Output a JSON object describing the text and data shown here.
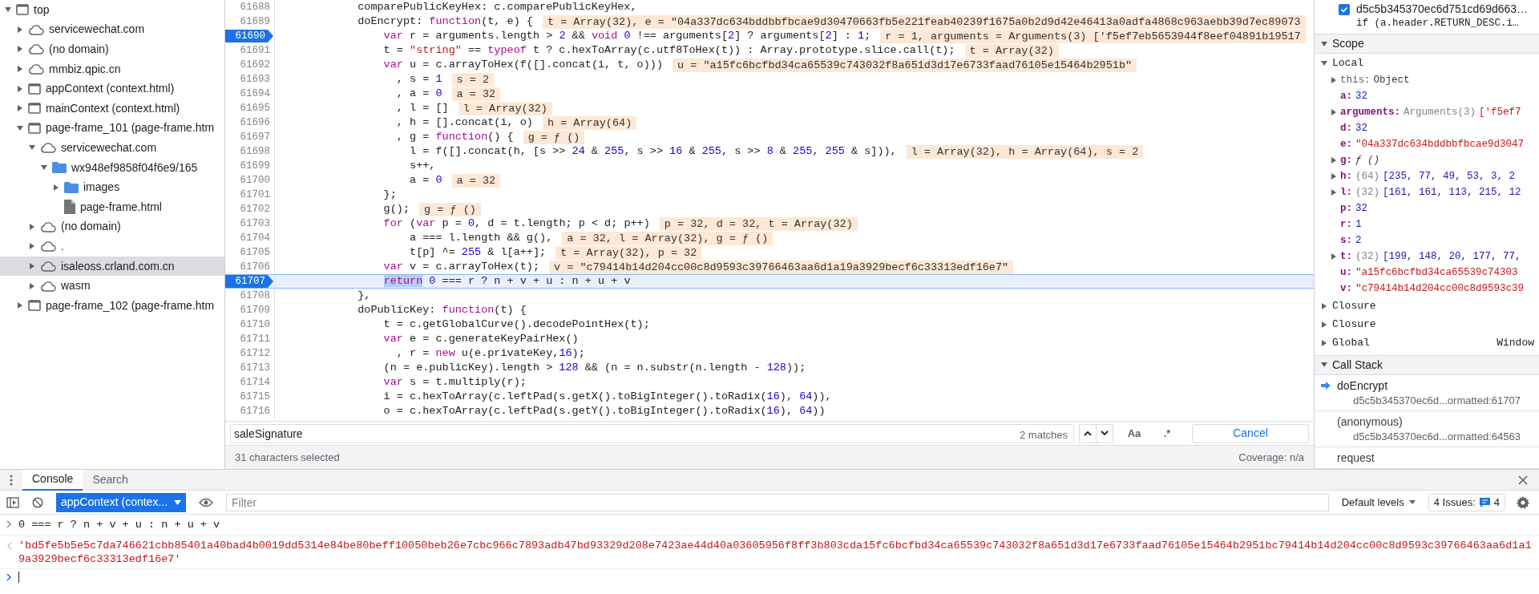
{
  "sidebar": {
    "tree": [
      {
        "label": "top",
        "kind": "frame",
        "expanded": true,
        "selected": false,
        "children": [
          {
            "label": "servicewechat.com",
            "kind": "cloud",
            "expanded": false,
            "selected": false
          },
          {
            "label": "(no domain)",
            "kind": "cloud",
            "expanded": false,
            "selected": false
          },
          {
            "label": "mmbiz.qpic.cn",
            "kind": "cloud",
            "expanded": false,
            "selected": false
          },
          {
            "label": "appContext (context.html)",
            "kind": "frame",
            "expanded": false,
            "selected": false
          },
          {
            "label": "mainContext (context.html)",
            "kind": "frame",
            "expanded": false,
            "selected": false
          },
          {
            "label": "page-frame_101 (page-frame.htm",
            "kind": "frame",
            "expanded": true,
            "selected": false,
            "children": [
              {
                "label": "servicewechat.com",
                "kind": "cloud",
                "expanded": true,
                "selected": false,
                "children": [
                  {
                    "label": "wx948ef9858f04f6e9/165",
                    "kind": "folder",
                    "expanded": true,
                    "selected": false,
                    "children": [
                      {
                        "label": "images",
                        "kind": "folder",
                        "expanded": false,
                        "selected": false
                      },
                      {
                        "label": "page-frame.html",
                        "kind": "file",
                        "selected": false
                      }
                    ]
                  }
                ]
              },
              {
                "label": "(no domain)",
                "kind": "cloud",
                "expanded": false,
                "selected": false
              },
              {
                "label": ".",
                "kind": "cloud",
                "expanded": false,
                "selected": false
              },
              {
                "label": "isaleoss.crland.com.cn",
                "kind": "cloud",
                "expanded": false,
                "selected": true
              },
              {
                "label": "wasm",
                "kind": "cloud",
                "expanded": false,
                "selected": false
              }
            ]
          },
          {
            "label": "page-frame_102 (page-frame.htm",
            "kind": "frame",
            "expanded": false,
            "selected": false
          }
        ]
      }
    ]
  },
  "editor": {
    "lines": [
      {
        "number": "61688",
        "breakpoint": false,
        "current": false,
        "tokens": [
          {
            "kind": "plain",
            "text": "            comparePublicKeyHex: c.comparePublicKeyHex,"
          }
        ]
      },
      {
        "number": "61689",
        "breakpoint": false,
        "current": false,
        "tokens": [
          {
            "kind": "plain",
            "text": "            doEncrypt: "
          },
          {
            "kind": "keyword",
            "text": "function"
          },
          {
            "kind": "plain",
            "text": "(t, e) {"
          }
        ],
        "inline_value": "t = Array(32), e = \"04a337dc634bddbbfbcae9d30470663fb5e221feab40239f1675a0b2d9d42e46413a0adfa4868c963aebb39d7ec89073"
      },
      {
        "number": "61690",
        "breakpoint": true,
        "current": false,
        "tokens": [
          {
            "kind": "keyword",
            "text": "                var"
          },
          {
            "kind": "plain",
            "text": " r = arguments.length > "
          },
          {
            "kind": "number",
            "text": "2"
          },
          {
            "kind": "plain",
            "text": " && "
          },
          {
            "kind": "keyword",
            "text": "void"
          },
          {
            "kind": "number",
            "text": " 0"
          },
          {
            "kind": "plain",
            "text": " !== arguments["
          },
          {
            "kind": "number",
            "text": "2"
          },
          {
            "kind": "plain",
            "text": "] ? arguments["
          },
          {
            "kind": "number",
            "text": "2"
          },
          {
            "kind": "plain",
            "text": "] : "
          },
          {
            "kind": "number",
            "text": "1"
          },
          {
            "kind": "plain",
            "text": ";"
          }
        ],
        "inline_value": "r = 1, arguments = Arguments(3) ['f5ef7eb5653944f8eef04891b19517"
      },
      {
        "number": "61691",
        "breakpoint": false,
        "current": false,
        "tokens": [
          {
            "kind": "plain",
            "text": "                t = "
          },
          {
            "kind": "string",
            "text": "\"string\""
          },
          {
            "kind": "plain",
            "text": " == "
          },
          {
            "kind": "keyword",
            "text": "typeof"
          },
          {
            "kind": "plain",
            "text": " t ? c.hexToArray(c.utf8ToHex(t)) : Array.prototype.slice.call(t);"
          }
        ],
        "inline_value": "t = Array(32)"
      },
      {
        "number": "61692",
        "breakpoint": false,
        "current": false,
        "tokens": [
          {
            "kind": "keyword",
            "text": "                var"
          },
          {
            "kind": "plain",
            "text": " u = c.arrayToHex(f([].concat(i, t, o)))"
          }
        ],
        "inline_value": "u = \"a15fc6bcfbd34ca65539c743032f8a651d3d17e6733faad76105e15464b2951b\""
      },
      {
        "number": "61693",
        "breakpoint": false,
        "current": false,
        "tokens": [
          {
            "kind": "plain",
            "text": "                  , s = "
          },
          {
            "kind": "number",
            "text": "1"
          }
        ],
        "inline_value": "s = 2"
      },
      {
        "number": "61694",
        "breakpoint": false,
        "current": false,
        "tokens": [
          {
            "kind": "plain",
            "text": "                  , a = "
          },
          {
            "kind": "number",
            "text": "0"
          }
        ],
        "inline_value": "a = 32"
      },
      {
        "number": "61695",
        "breakpoint": false,
        "current": false,
        "tokens": [
          {
            "kind": "plain",
            "text": "                  , l = []"
          }
        ],
        "inline_value": "l = Array(32)"
      },
      {
        "number": "61696",
        "breakpoint": false,
        "current": false,
        "tokens": [
          {
            "kind": "plain",
            "text": "                  , h = [].concat(i, o)"
          }
        ],
        "inline_value": "h = Array(64)"
      },
      {
        "number": "61697",
        "breakpoint": false,
        "current": false,
        "tokens": [
          {
            "kind": "plain",
            "text": "                  , g = "
          },
          {
            "kind": "keyword",
            "text": "function"
          },
          {
            "kind": "plain",
            "text": "() {"
          }
        ],
        "inline_value": "g = ƒ ()"
      },
      {
        "number": "61698",
        "breakpoint": false,
        "current": false,
        "tokens": [
          {
            "kind": "plain",
            "text": "                    l = f([].concat(h, [s >> "
          },
          {
            "kind": "number",
            "text": "24"
          },
          {
            "kind": "plain",
            "text": " & "
          },
          {
            "kind": "number",
            "text": "255"
          },
          {
            "kind": "plain",
            "text": ", s >> "
          },
          {
            "kind": "number",
            "text": "16"
          },
          {
            "kind": "plain",
            "text": " & "
          },
          {
            "kind": "number",
            "text": "255"
          },
          {
            "kind": "plain",
            "text": ", s >> "
          },
          {
            "kind": "number",
            "text": "8"
          },
          {
            "kind": "plain",
            "text": " & "
          },
          {
            "kind": "number",
            "text": "255"
          },
          {
            "kind": "plain",
            "text": ", "
          },
          {
            "kind": "number",
            "text": "255"
          },
          {
            "kind": "plain",
            "text": " & s])),"
          }
        ],
        "inline_value": "l = Array(32), h = Array(64), s = 2"
      },
      {
        "number": "61699",
        "breakpoint": false,
        "current": false,
        "tokens": [
          {
            "kind": "plain",
            "text": "                    s++,"
          }
        ]
      },
      {
        "number": "61700",
        "breakpoint": false,
        "current": false,
        "tokens": [
          {
            "kind": "plain",
            "text": "                    a = "
          },
          {
            "kind": "number",
            "text": "0"
          }
        ],
        "inline_value": "a = 32"
      },
      {
        "number": "61701",
        "breakpoint": false,
        "current": false,
        "tokens": [
          {
            "kind": "plain",
            "text": "                };"
          }
        ]
      },
      {
        "number": "61702",
        "breakpoint": false,
        "current": false,
        "tokens": [
          {
            "kind": "plain",
            "text": "                g();"
          }
        ],
        "inline_value": "g = ƒ ()"
      },
      {
        "number": "61703",
        "breakpoint": false,
        "current": false,
        "tokens": [
          {
            "kind": "keyword",
            "text": "                for"
          },
          {
            "kind": "plain",
            "text": " ("
          },
          {
            "kind": "keyword",
            "text": "var"
          },
          {
            "kind": "plain",
            "text": " p = "
          },
          {
            "kind": "number",
            "text": "0"
          },
          {
            "kind": "plain",
            "text": ", d = t.length; p < d; p++)"
          }
        ],
        "inline_value": "p = 32, d = 32, t = Array(32)"
      },
      {
        "number": "61704",
        "breakpoint": false,
        "current": false,
        "tokens": [
          {
            "kind": "plain",
            "text": "                    a === l.length && g(),"
          }
        ],
        "inline_value": "a = 32, l = Array(32), g = ƒ ()"
      },
      {
        "number": "61705",
        "breakpoint": false,
        "current": false,
        "tokens": [
          {
            "kind": "plain",
            "text": "                    t[p] ^= "
          },
          {
            "kind": "number",
            "text": "255"
          },
          {
            "kind": "plain",
            "text": " & l[a++];"
          }
        ],
        "inline_value": "t = Array(32), p = 32"
      },
      {
        "number": "61706",
        "breakpoint": false,
        "current": false,
        "tokens": [
          {
            "kind": "keyword",
            "text": "                var"
          },
          {
            "kind": "plain",
            "text": " v = c.arrayToHex(t);"
          }
        ],
        "inline_value": "v = \"c79414b14d204cc00c8d9593c39766463aa6d1a19a3929becf6c33313edf16e7\""
      },
      {
        "number": "61707",
        "breakpoint": true,
        "current": true,
        "tokens": [
          {
            "kind": "selected_keyword",
            "text": "                return"
          },
          {
            "kind": "number",
            "text": " 0"
          },
          {
            "kind": "plain",
            "text": " === r ? n + v + u : n + u + v"
          }
        ]
      },
      {
        "number": "61708",
        "breakpoint": false,
        "current": false,
        "tokens": [
          {
            "kind": "plain",
            "text": "            },"
          }
        ]
      },
      {
        "number": "61709",
        "breakpoint": false,
        "current": false,
        "tokens": [
          {
            "kind": "plain",
            "text": "            doPublicKey: "
          },
          {
            "kind": "keyword",
            "text": "function"
          },
          {
            "kind": "plain",
            "text": "(t) {"
          }
        ]
      },
      {
        "number": "61710",
        "breakpoint": false,
        "current": false,
        "tokens": [
          {
            "kind": "plain",
            "text": "                t = c.getGlobalCurve().decodePointHex(t);"
          }
        ]
      },
      {
        "number": "61711",
        "breakpoint": false,
        "current": false,
        "tokens": [
          {
            "kind": "keyword",
            "text": "                var"
          },
          {
            "kind": "plain",
            "text": " e = c.generateKeyPairHex()"
          }
        ]
      },
      {
        "number": "61712",
        "breakpoint": false,
        "current": false,
        "tokens": [
          {
            "kind": "plain",
            "text": "                  , r = "
          },
          {
            "kind": "keyword",
            "text": "new"
          },
          {
            "kind": "plain",
            "text": " u(e.privateKey,"
          },
          {
            "kind": "number",
            "text": "16"
          },
          {
            "kind": "plain",
            "text": ");"
          }
        ]
      },
      {
        "number": "61713",
        "breakpoint": false,
        "current": false,
        "tokens": [
          {
            "kind": "plain",
            "text": "                (n = e.publicKey).length > "
          },
          {
            "kind": "number",
            "text": "128"
          },
          {
            "kind": "plain",
            "text": " && (n = n.substr(n.length - "
          },
          {
            "kind": "number",
            "text": "128"
          },
          {
            "kind": "plain",
            "text": "));"
          }
        ]
      },
      {
        "number": "61714",
        "breakpoint": false,
        "current": false,
        "tokens": [
          {
            "kind": "keyword",
            "text": "                var"
          },
          {
            "kind": "plain",
            "text": " s = t.multiply(r);"
          }
        ]
      },
      {
        "number": "61715",
        "breakpoint": false,
        "current": false,
        "tokens": [
          {
            "kind": "plain",
            "text": "                i = c.hexToArray(c.leftPad(s.getX().toBigInteger().toRadix("
          },
          {
            "kind": "number",
            "text": "16"
          },
          {
            "kind": "plain",
            "text": "), "
          },
          {
            "kind": "number",
            "text": "64"
          },
          {
            "kind": "plain",
            "text": ")),"
          }
        ]
      },
      {
        "number": "61716",
        "breakpoint": false,
        "current": false,
        "tokens": [
          {
            "kind": "plain",
            "text": "                o = c.hexToArray(c.leftPad(s.getY().toBigInteger().toRadix("
          },
          {
            "kind": "number",
            "text": "16"
          },
          {
            "kind": "plain",
            "text": "), "
          },
          {
            "kind": "number",
            "text": "64"
          },
          {
            "kind": "plain",
            "text": "))"
          }
        ]
      }
    ],
    "search": {
      "value": "saleSignature",
      "matches": "2 matches",
      "case_label": "Aa",
      "regex_label": ".*",
      "cancel": "Cancel"
    },
    "status_bar": {
      "selection": "31 characters selected",
      "coverage": "Coverage: n/a"
    }
  },
  "debugger": {
    "breakpoints": [
      {
        "file": "d5c5b345370ec6d751cd69d663…",
        "code": "if (a.header.RETURN_DESC.i…",
        "checked": true
      }
    ],
    "scope": {
      "title": "Scope",
      "expanded": true,
      "sections": [
        {
          "label": "Local",
          "expanded": true,
          "variables": [
            {
              "name": "this:",
              "bold": false,
              "expandable": true,
              "kind": "object",
              "value": "Object"
            },
            {
              "name": "a:",
              "bold": true,
              "expandable": false,
              "kind": "number",
              "value": "32"
            },
            {
              "name": "arguments:",
              "bold": true,
              "expandable": true,
              "kind": "string",
              "count": "Arguments(3)",
              "value": "['f5ef7"
            },
            {
              "name": "d:",
              "bold": true,
              "expandable": false,
              "kind": "number",
              "value": "32"
            },
            {
              "name": "e:",
              "bold": true,
              "expandable": false,
              "kind": "string",
              "value": "\"04a337dc634bddbbfbcae9d3047"
            },
            {
              "name": "g:",
              "bold": true,
              "expandable": true,
              "kind": "function",
              "value": "ƒ ()"
            },
            {
              "name": "h:",
              "bold": true,
              "expandable": true,
              "kind": "number",
              "count": "(64)",
              "value": "[235, 77, 49, 53, 3, 2"
            },
            {
              "name": "l:",
              "bold": true,
              "expandable": true,
              "kind": "number",
              "count": "(32)",
              "value": "[161, 161, 113, 215, 12"
            },
            {
              "name": "p:",
              "bold": true,
              "expandable": false,
              "kind": "number",
              "value": "32"
            },
            {
              "name": "r:",
              "bold": true,
              "expandable": false,
              "kind": "number",
              "value": "1"
            },
            {
              "name": "s:",
              "bold": true,
              "expandable": false,
              "kind": "number",
              "value": "2"
            },
            {
              "name": "t:",
              "bold": true,
              "expandable": true,
              "kind": "number",
              "count": "(32)",
              "value": "[199, 148, 20, 177, 77,"
            },
            {
              "name": "u:",
              "bold": true,
              "expandable": false,
              "kind": "string",
              "value": "\"a15fc6bcfbd34ca65539c74303"
            },
            {
              "name": "v:",
              "bold": true,
              "expandable": false,
              "kind": "string",
              "value": "\"c79414b14d204cc00c8d9593c39"
            }
          ]
        },
        {
          "label": "Closure",
          "expanded": false
        },
        {
          "label": "Closure",
          "expanded": false
        },
        {
          "label": "Global",
          "expanded": false,
          "value": "Window"
        }
      ]
    },
    "call_stack": {
      "title": "Call Stack",
      "expanded": true,
      "frames": [
        {
          "function": "doEncrypt",
          "location": "d5c5b345370ec6d...ormatted:61707",
          "current": true
        },
        {
          "function": "(anonymous)",
          "location": "d5c5b345370ec6d...ormatted:64563",
          "current": false
        },
        {
          "function": "request",
          "current": false
        }
      ]
    }
  },
  "drawer": {
    "tabs": [
      {
        "label": "Console",
        "selected": true
      },
      {
        "label": "Search",
        "selected": false
      }
    ],
    "toolbar": {
      "context": "appContext (contex...",
      "filter_placeholder": "Filter",
      "levels": "Default levels",
      "issues_label": "4 Issues:",
      "issues_count": "4"
    },
    "console": [
      {
        "kind": "input",
        "text": "0 === r ? n + v + u : n + u + v"
      },
      {
        "kind": "result",
        "text": "'bd5fe5b5e5c7da746621cbb85401a40bad4b0019dd5314e84be80beff10050beb26e7cbc966c7893adb47bd93329d208e7423ae44d40a03605956f8ff3b803cda15fc6bcfbd34ca65539c743032f8a651d3d17e6733faad76105e15464b2951bc79414b14d204cc00c8d9593c39766463aa6d1a19a3929becf6c33313edf16e7'"
      },
      {
        "kind": "prompt"
      }
    ]
  }
}
